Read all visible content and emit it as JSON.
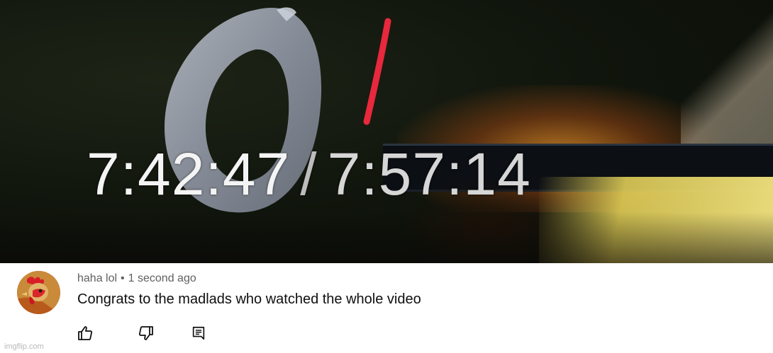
{
  "video": {
    "current_time": "7:42:47",
    "separator": "/",
    "total_time": "7:57:14"
  },
  "comment": {
    "author": "haha lol",
    "meta_separator": "•",
    "timestamp": "1 second ago",
    "text": "Congrats to the madlads who watched the whole video",
    "avatar_icon": "rooster-avatar-icon",
    "actions": [
      {
        "name": "like-button",
        "icon": "thumbs-up-icon"
      },
      {
        "name": "dislike-button",
        "icon": "thumbs-down-icon"
      },
      {
        "name": "reply-button",
        "icon": "comment-icon"
      }
    ]
  },
  "watermark": {
    "text": "imgflip.com"
  },
  "colors": {
    "annotation_red": "#e8283c",
    "meta_gray": "#606060",
    "text_dark": "#0f0f0f"
  }
}
